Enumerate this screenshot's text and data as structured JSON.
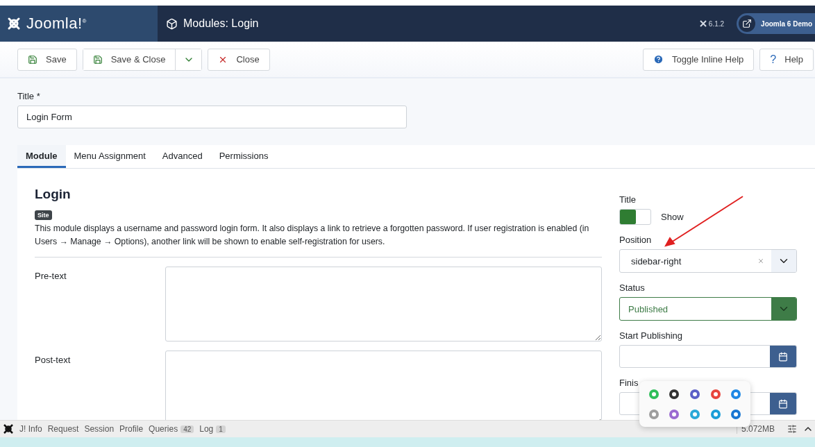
{
  "header": {
    "logo": "Joomla!$^{®}$",
    "page_title": "Modules: Login",
    "version": "6.1.2",
    "site_link": "Joomla 6 Demo"
  },
  "toolbar": {
    "left": [
      {
        "kind": "save",
        "label": "Save"
      },
      {
        "kind": "save-close",
        "label": "Save & Close"
      },
      {
        "kind": "close",
        "label": "Close"
      }
    ],
    "right": [
      {
        "kind": "toggle-help",
        "label": "Toggle Inline Help"
      },
      {
        "kind": "help",
        "icon": "?",
        "label": "Help"
      }
    ]
  },
  "title_field": {
    "label": "Title *",
    "value": "Login Form"
  },
  "tabs": [
    {
      "label": "Module",
      "selected": true
    },
    {
      "label": "Menu Assignment",
      "selected": false
    },
    {
      "label": "Advanced",
      "selected": false
    },
    {
      "label": "Permissions",
      "selected": false
    }
  ],
  "module": {
    "name": "Login",
    "badge": "Site",
    "description": "This module displays a username and password login form. It also displays a link to retrieve a forgotten password. If user registration is enabled (in Users → Manage → Options), another link will be shown to enable self-registration for users.",
    "fields": [
      {
        "label": "Pre-text"
      },
      {
        "label": "Post-text"
      }
    ]
  },
  "sidebar": {
    "title_toggle": {
      "label": "Title",
      "on": true,
      "text": "Show"
    },
    "position": {
      "label": "Position",
      "value": "sidebar-right"
    },
    "status": {
      "label": "Status",
      "value": "Published"
    },
    "start_publishing": {
      "label": "Start Publishing"
    },
    "finish": {
      "label": "Finis"
    }
  },
  "debug_bar": {
    "items": [
      {
        "label": "J! Info"
      },
      {
        "label": "Request"
      },
      {
        "label": "Session"
      },
      {
        "label": "Profile"
      },
      {
        "label": "Queries",
        "count": "42"
      },
      {
        "label": "Log",
        "count": "1"
      }
    ],
    "memory": "5.072MB"
  }
}
